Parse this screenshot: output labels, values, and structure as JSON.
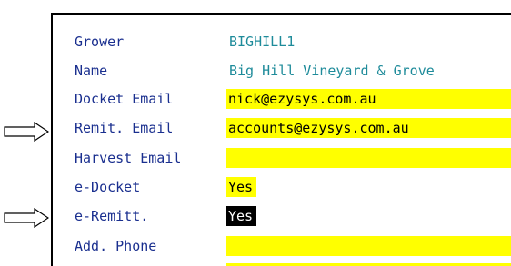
{
  "form": {
    "rows": [
      {
        "label": "Grower",
        "value": "BIGHILL1"
      },
      {
        "label": "Name",
        "value": "Big Hill Vineyard & Grove"
      },
      {
        "label": "Docket Email",
        "value": "nick@ezysys.com.au"
      },
      {
        "label": "Remit. Email",
        "value": "accounts@ezysys.com.au"
      },
      {
        "label": "Harvest Email",
        "value": ""
      },
      {
        "label": "e-Docket",
        "value": "Yes"
      },
      {
        "label": "e-Remitt.",
        "value": "Yes"
      },
      {
        "label": "Add. Phone",
        "value": ""
      }
    ]
  },
  "colors": {
    "label": "#1a2f8f",
    "plain_value": "#1e8b9a",
    "field_highlight": "#ffff00",
    "selected_bg": "#000000",
    "selected_text": "#ffffff"
  },
  "annotations": [
    {
      "icon": "right-arrow-icon",
      "points_to": "Remit. Email"
    },
    {
      "icon": "right-arrow-icon",
      "points_to": "e-Remitt."
    }
  ]
}
